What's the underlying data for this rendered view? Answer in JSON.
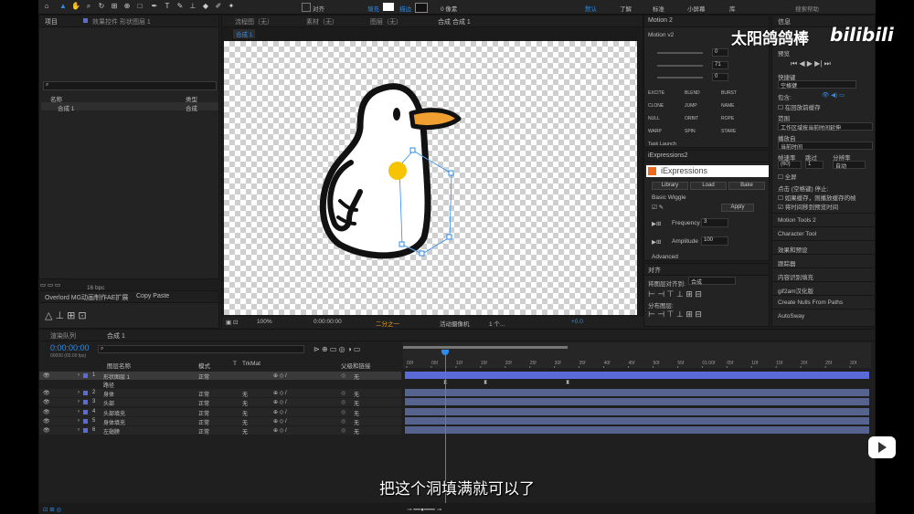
{
  "toolbar": {
    "align_label": "对齐",
    "fill_label": "填充",
    "stroke_label": "描边",
    "stroke_width": "0 像素",
    "workspaces": [
      "默认",
      "了解",
      "标准",
      "小屏幕",
      "库"
    ],
    "search_placeholder": "搜索帮助"
  },
  "project_panel": {
    "tab": "项目",
    "effects_tab": "效果控件 形状图层 1",
    "col_name": "名称",
    "col_type": "类型",
    "item_name": "合成 1",
    "item_type": "合成",
    "bpc": "16 bpc"
  },
  "overlord_panel": {
    "tab": "Overlord MG动画制作AE扩展",
    "tab2": "Copy Paste"
  },
  "comp_viewer": {
    "tabs": [
      "流程图（无）",
      "素材（无）",
      "图层（无）",
      "合成 合成 1"
    ],
    "comp_tab": "合成 1",
    "zoom": "100%",
    "timecode": "0:00:00:00",
    "resolution": "二分之一",
    "camera": "活动摄像机",
    "views": "1 个...",
    "exposure": "+0.0"
  },
  "motion2": {
    "title": "Motion 2",
    "version": "Motion v2",
    "values": [
      "0",
      "71",
      "0"
    ],
    "buttons": [
      "EXCITE",
      "BLEND",
      "BURST",
      "CLONE",
      "JUMP",
      "NAME",
      "NULL",
      "ORBIT",
      "ROPE",
      "WARP",
      "SPIN",
      "STARE"
    ],
    "task_launch": "Task Launch"
  },
  "iexpressions": {
    "tab": "iExpressions2",
    "logo": "iExpressions",
    "tabs": [
      "Library",
      "Load",
      "Bake"
    ],
    "preset": "Basic Wiggle",
    "apply": "Apply",
    "frequency_label": "Frequency",
    "frequency": "3",
    "amplitude_label": "Amplitude",
    "amplitude": "100",
    "advanced": "Advanced"
  },
  "align_panel": {
    "tab": "对齐",
    "align_to_label": "将图层对齐到:",
    "align_to": "合成",
    "distribute": "分布图层:"
  },
  "right_panel": {
    "info": "信息",
    "preview": "预览",
    "shortcut_label": "快捷键",
    "shortcut": "空格键",
    "include": "包含:",
    "cache_before": "在回放前缓存",
    "range_label": "范围",
    "range": "工作区域按当前时间延伸",
    "play_from_label": "播放自",
    "play_from": "当前时间",
    "frame_rate_label": "帧速率",
    "skip_label": "跳过",
    "resolution_label": "分辨率",
    "frame_rate": "(60)",
    "skip": "1",
    "resolution": "自动",
    "fullscreen": "全屏",
    "on_stop": "点击 (空格键) 停止:",
    "if_cached": "如果缓存，则播放缓存的帧",
    "move_time": "将时间移到预览时间",
    "list": [
      "Motion Tools 2",
      "Character Tool",
      "效果和预设",
      "跟踪器",
      "内容识别填充",
      "gif2am汉化版",
      "Create Nulls From Paths",
      "AutoSway"
    ]
  },
  "timeline": {
    "render_queue": "渲染队列",
    "comp_tab": "合成 1",
    "timecode": "0:00:00:00",
    "fps_note": "00000 (60.00 fps)",
    "headers": {
      "name": "图层名称",
      "mode": "模式",
      "t": "T",
      "trkmat": "TrkMat",
      "parent": "父级和链接"
    },
    "ruler": [
      "00f",
      "05f",
      "10f",
      "15f",
      "20f",
      "25f",
      "30f",
      "35f",
      "40f",
      "45f",
      "50f",
      "55f",
      "01:00f",
      "05f",
      "10f",
      "15f",
      "20f",
      "25f",
      "30f"
    ],
    "layers": [
      {
        "num": "1",
        "name": "形状图层 1",
        "mode": "正常",
        "trk": "",
        "parent": "无",
        "color": "#5b6bd6"
      },
      {
        "num": "",
        "name": "路径",
        "mode": "",
        "trk": "",
        "parent": "",
        "color": ""
      },
      {
        "num": "2",
        "name": "身体",
        "mode": "正常",
        "trk": "无",
        "parent": "无",
        "color": "#5b6bd6"
      },
      {
        "num": "3",
        "name": "头部",
        "mode": "正常",
        "trk": "无",
        "parent": "无",
        "color": "#5b6bd6"
      },
      {
        "num": "4",
        "name": "头部填充",
        "mode": "正常",
        "trk": "无",
        "parent": "无",
        "color": "#5b6bd6"
      },
      {
        "num": "5",
        "name": "身体填充",
        "mode": "正常",
        "trk": "无",
        "parent": "无",
        "color": "#5b6bd6"
      },
      {
        "num": "6",
        "name": "左翅膀",
        "mode": "正常",
        "trk": "无",
        "parent": "无",
        "color": "#5b6bd6"
      }
    ]
  },
  "overlay": {
    "subtitle": "把这个洞填满就可以了",
    "watermark": "太阳鸽鸽棒",
    "bili_logo": "bilibili"
  },
  "colors": {
    "accent": "#2d8ceb",
    "layer_bar": "#56638f",
    "orange": "#f0a030",
    "highlight": "#f6c400"
  }
}
